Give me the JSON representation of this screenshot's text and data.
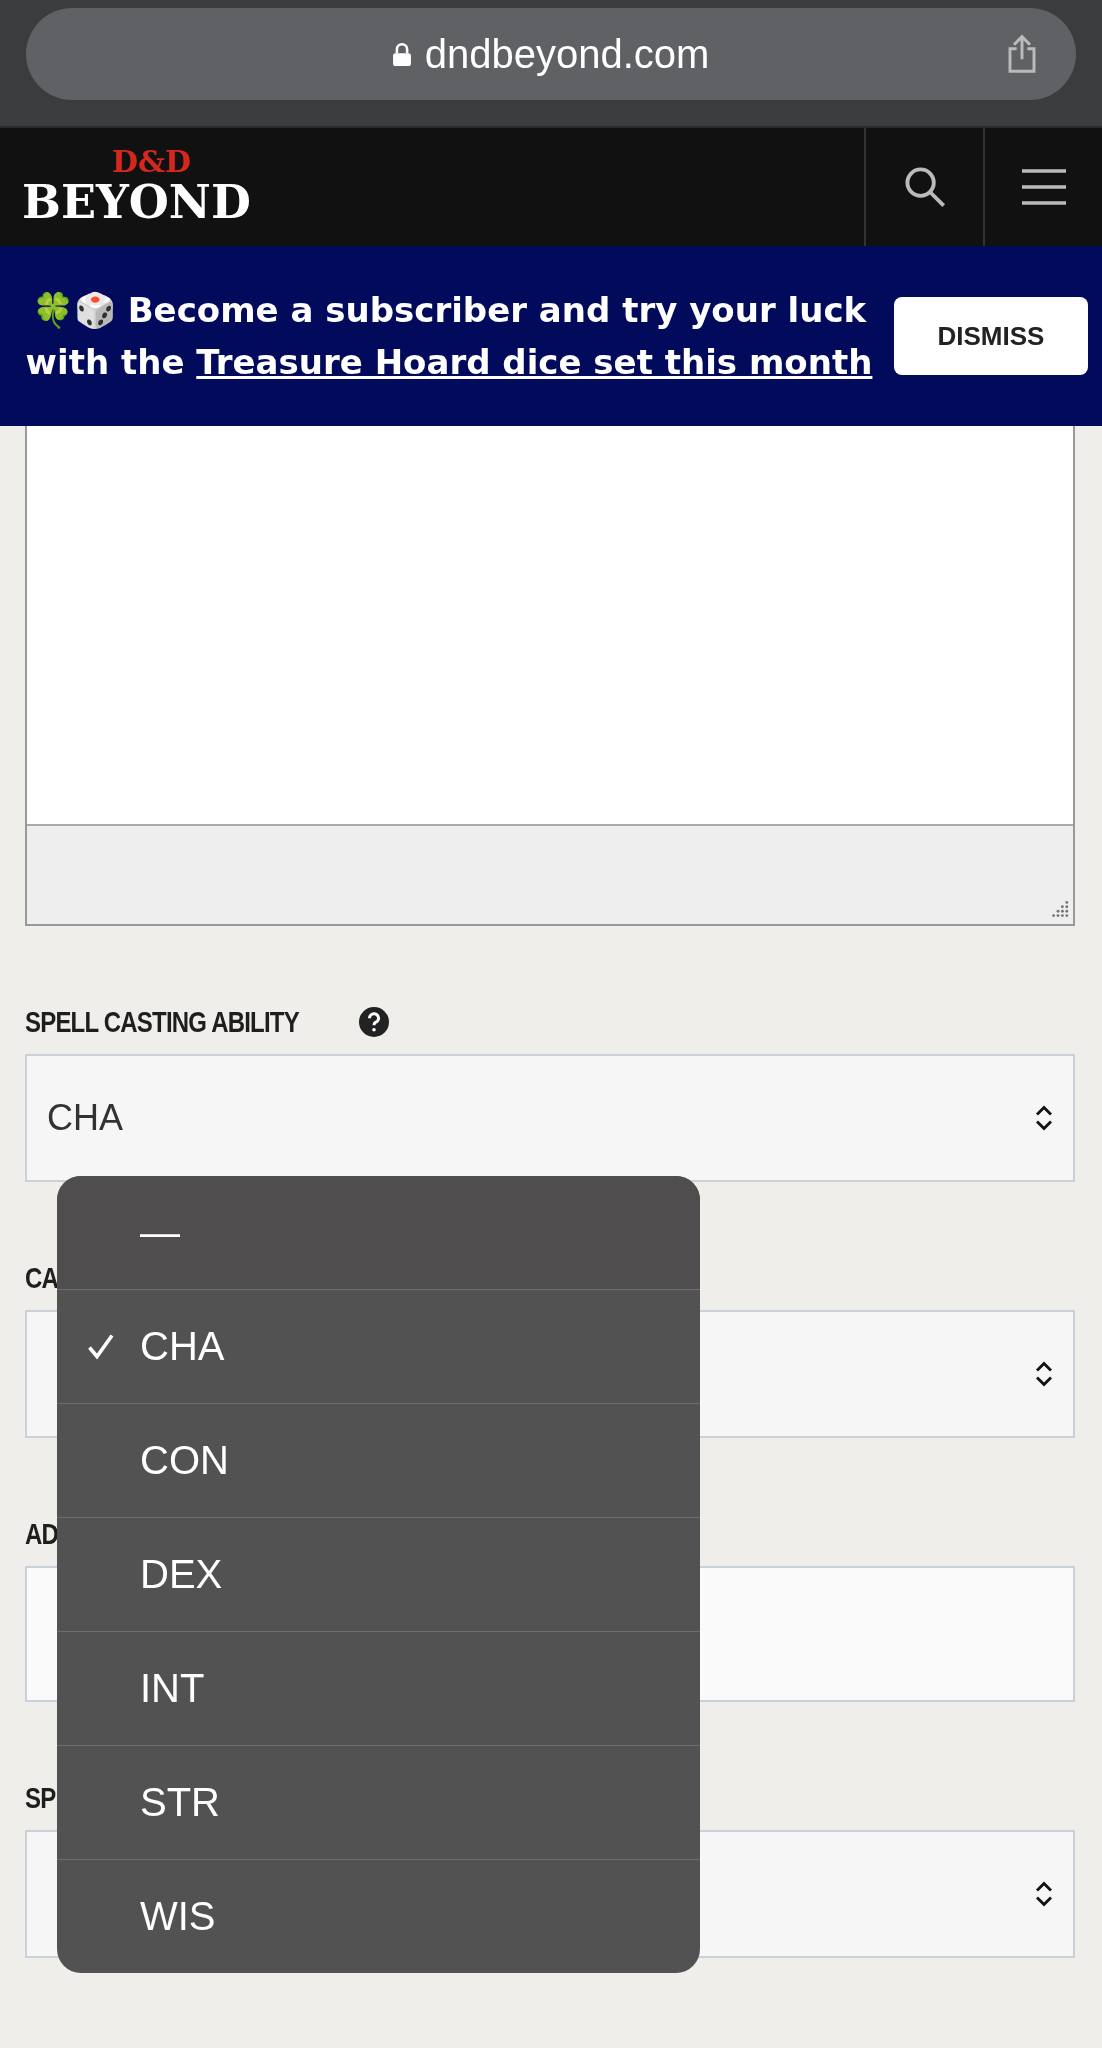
{
  "browser": {
    "url": "dndbeyond.com"
  },
  "header": {
    "logo_top": "D&D",
    "logo_bottom": "BEYOND"
  },
  "banner": {
    "emoji": "🍀🎲",
    "text_before": "Become a subscriber and try your luck with the",
    "link": "Treasure Hoard dice set this month",
    "dismiss": "DISMISS"
  },
  "fields": [
    {
      "kind": "select",
      "label": "SPELL CASTING ABILITY",
      "help": true,
      "value": "CHA"
    },
    {
      "kind": "select",
      "label": "CA"
    },
    {
      "kind": "input",
      "label": "AD"
    },
    {
      "kind": "select",
      "label": "SP"
    }
  ],
  "menu": {
    "options": [
      {
        "label": "—",
        "selected": false
      },
      {
        "label": "CHA",
        "selected": true
      },
      {
        "label": "CON",
        "selected": false
      },
      {
        "label": "DEX",
        "selected": false
      },
      {
        "label": "INT",
        "selected": false
      },
      {
        "label": "STR",
        "selected": false
      },
      {
        "label": "WIS",
        "selected": false
      }
    ]
  }
}
